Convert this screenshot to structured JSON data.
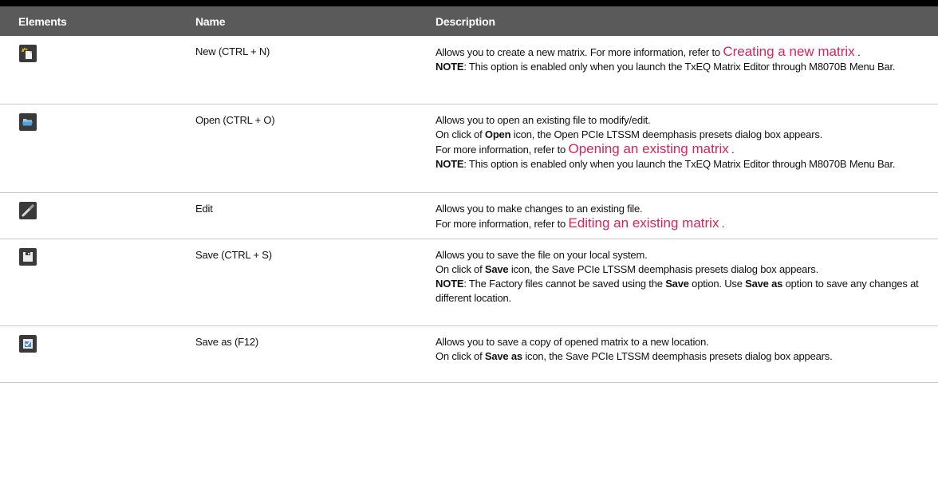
{
  "table": {
    "headers": [
      "Elements",
      "Name",
      "Description"
    ],
    "rows": [
      {
        "icon": "new-file-icon",
        "name": "New (CTRL + N)",
        "desc_pre": "Allows you to create a new matrix. For more information, refer to ",
        "desc_link": "Creating a new matrix",
        "desc_post": " .",
        "note_label": "NOTE",
        "note_text": ": This option is enabled only when you launch the TxEQ Matrix Editor through M8070B Menu Bar."
      },
      {
        "icon": "open-folder-icon",
        "name": "Open (CTRL + O)",
        "line1": "Allows you to open an existing file to modify/edit.",
        "line2_pre": "On click of ",
        "line2_bold": "Open",
        "line2_post": " icon, the Open PCIe LTSSM deemphasis presets dialog box appears.",
        "line3_pre": "For more information, refer to ",
        "desc_link": "Opening an existing matrix",
        "line3_post": " .",
        "note_label": "NOTE",
        "note_text": ": This option is enabled only when you launch the TxEQ Matrix Editor through M8070B Menu Bar."
      },
      {
        "icon": "pencil-icon",
        "name": "Edit",
        "line1": "Allows you to make changes to an existing file.",
        "line2_pre": "For more information, refer to ",
        "desc_link": "Editing an existing matrix",
        "line2_post": " ."
      },
      {
        "icon": "save-disk-icon",
        "name": "Save (CTRL + S)",
        "line1": "Allows you to save the file on your local system.",
        "line2_pre": "On click of ",
        "line2_bold": "Save",
        "line2_post": " icon, the Save PCIe LTSSM deemphasis presets dialog box appears.",
        "note_label": "NOTE",
        "note_pre": ": The Factory files cannot be saved using the ",
        "note_bold1": "Save",
        "note_mid": " option. Use ",
        "note_bold2": "Save as",
        "note_post": " option to save any changes at different location."
      },
      {
        "icon": "save-as-icon",
        "name": "Save as (F12)",
        "line1": "Allows you to save a copy of opened matrix to a new location.",
        "line2_pre": "On click of ",
        "line2_bold": "Save as",
        "line2_post": " icon, the Save PCIe LTSSM deemphasis presets dialog box appears."
      }
    ]
  },
  "colors": {
    "header_bg": "#5a5a5a",
    "link": "#d6245a",
    "icon_bg": "#3a3a3a"
  }
}
